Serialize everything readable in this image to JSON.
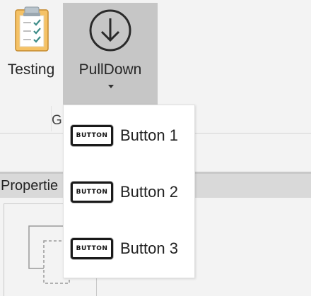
{
  "ribbon": {
    "testing_label": "Testing",
    "testing_icon": "clipboard-checklist-icon",
    "pulldown_label": "PullDown",
    "pulldown_icon": "circle-down-arrow-icon",
    "group_label": "G"
  },
  "dropdown": {
    "items": [
      {
        "label": "Button 1",
        "icon_text": "BUTTON",
        "icon": "button-icon"
      },
      {
        "label": "Button 2",
        "icon_text": "BUTTON",
        "icon": "button-icon"
      },
      {
        "label": "Button 3",
        "icon_text": "BUTTON",
        "icon": "button-icon"
      }
    ]
  },
  "properties": {
    "title": "Propertie"
  },
  "colors": {
    "ribbon_background": "#f3f3f3",
    "pulldown_pressed": "#c6c6c6",
    "panel_header": "#d9d9d9",
    "dropdown_background": "#ffffff",
    "clipboard_board": "#f5c266",
    "checkmark": "#3c8c88"
  }
}
